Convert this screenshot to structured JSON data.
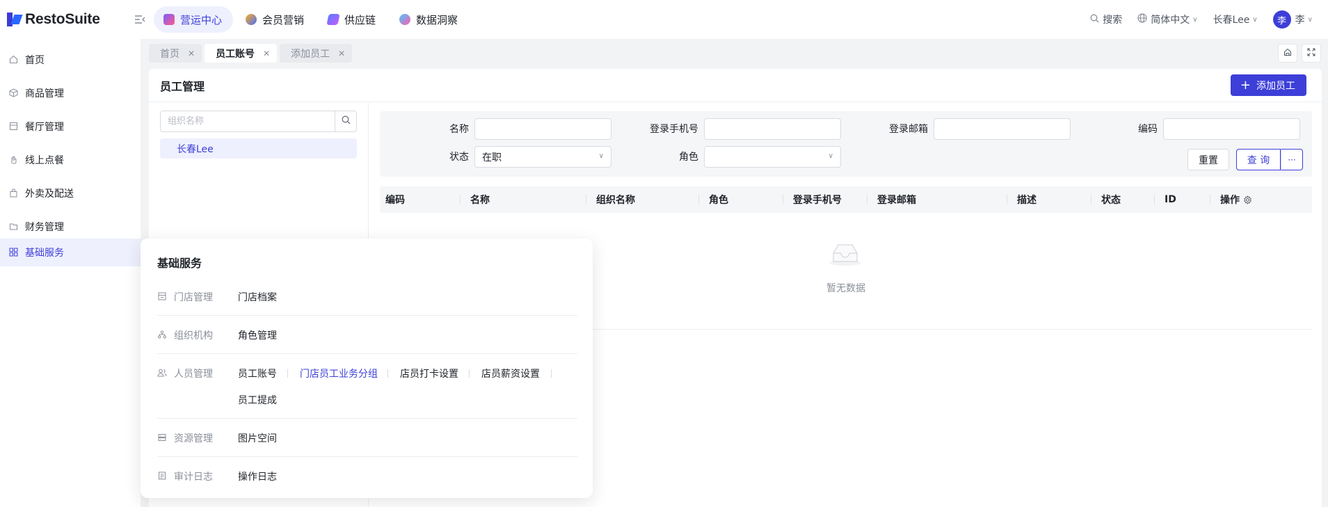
{
  "app": {
    "logo_text": "RestoSuite"
  },
  "topnav": [
    {
      "label": "营运中心",
      "icon": "ops-center-icon",
      "active": true
    },
    {
      "label": "会员营销",
      "icon": "member-marketing-icon"
    },
    {
      "label": "供应链",
      "icon": "supply-chain-icon"
    },
    {
      "label": "数据洞察",
      "icon": "data-insight-icon"
    }
  ],
  "header_right": {
    "search_label": "搜索",
    "language": "简体中文",
    "org": "长春Lee",
    "avatar_char": "李",
    "user": "李"
  },
  "sidebar": {
    "items": [
      {
        "label": "首页",
        "icon": "home-icon"
      },
      {
        "label": "商品管理",
        "icon": "cube-icon"
      },
      {
        "label": "餐厅管理",
        "icon": "store-icon"
      },
      {
        "label": "线上点餐",
        "icon": "hand-icon"
      },
      {
        "label": "外卖及配送",
        "icon": "bag-icon"
      },
      {
        "label": "财务管理",
        "icon": "folder-icon"
      },
      {
        "label": "基础服务",
        "icon": "grid-icon",
        "active": true
      }
    ]
  },
  "tabs": [
    {
      "label": "首页"
    },
    {
      "label": "员工账号",
      "active": true
    },
    {
      "label": "添加员工"
    }
  ],
  "page": {
    "title": "员工管理",
    "add_button": "添加员工",
    "org_search_placeholder": "组织名称",
    "org_node": "长春Lee"
  },
  "filters": {
    "name_label": "名称",
    "phone_label": "登录手机号",
    "email_label": "登录邮箱",
    "code_label": "编码",
    "status_label": "状态",
    "status_value": "在职",
    "role_label": "角色",
    "reset": "重置",
    "query": "查 询",
    "more": "···"
  },
  "table": {
    "columns": [
      "编码",
      "名称",
      "组织名称",
      "角色",
      "登录手机号",
      "登录邮箱",
      "描述",
      "状态",
      "ID",
      "操作"
    ],
    "empty_text": "暂无数据"
  },
  "flyout": {
    "title": "基础服务",
    "groups": [
      {
        "category": "门店管理",
        "icon": "store-icon",
        "links": [
          "门店档案"
        ]
      },
      {
        "category": "组织机构",
        "icon": "org-tree-icon",
        "links": [
          "角色管理"
        ]
      },
      {
        "category": "人员管理",
        "icon": "people-icon",
        "links": [
          "员工账号",
          "门店员工业务分组",
          "店员打卡设置",
          "店员薪资设置",
          "员工提成"
        ],
        "highlight": "门店员工业务分组"
      },
      {
        "category": "资源管理",
        "icon": "server-icon",
        "links": [
          "图片空间"
        ]
      },
      {
        "category": "审计日志",
        "icon": "log-icon",
        "links": [
          "操作日志"
        ]
      }
    ]
  },
  "colors": {
    "accent": "#3d3fd8",
    "accent_bg": "#eef0fe"
  }
}
